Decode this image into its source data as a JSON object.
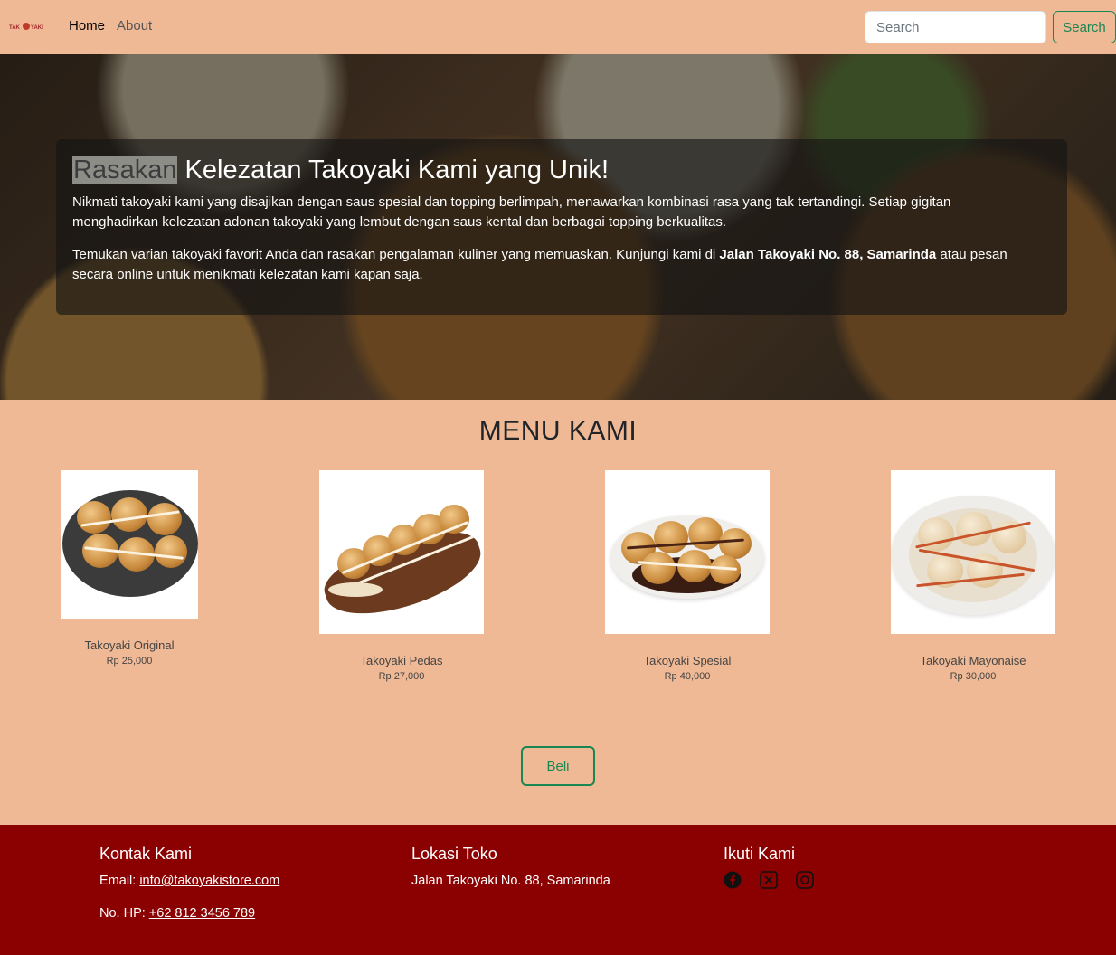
{
  "navbar": {
    "brand_icon": "takoyaki-logo",
    "home_label": "Home",
    "about_label": "About",
    "search_placeholder": "Search",
    "search_button": "Search"
  },
  "hero": {
    "title_highlight": "Rasakan",
    "title_rest": " Kelezatan Takoyaki Kami yang Unik!",
    "paragraph1": "Nikmati takoyaki kami yang disajikan dengan saus spesial dan topping berlimpah, menawarkan kombinasi rasa yang tak tertandingi. Setiap gigitan menghadirkan kelezatan adonan takoyaki yang lembut dengan saus kental dan berbagai topping berkualitas.",
    "paragraph2_before": "Temukan varian takoyaki favorit Anda dan rasakan pengalaman kuliner yang memuaskan. Kunjungi kami di ",
    "paragraph2_bold": "Jalan Takoyaki No. 88, Samarinda",
    "paragraph2_after": " atau pesan secara online untuk menikmati kelezatan kami kapan saja."
  },
  "menu": {
    "title": "MENU KAMI",
    "items": [
      {
        "name": "Takoyaki Original",
        "price": "Rp 25,000",
        "image": "takoyaki-original-photo"
      },
      {
        "name": "Takoyaki Pedas",
        "price": "Rp 27,000",
        "image": "takoyaki-pedas-photo"
      },
      {
        "name": "Takoyaki Spesial",
        "price": "Rp 40,000",
        "image": "takoyaki-spesial-photo"
      },
      {
        "name": "Takoyaki Mayonaise",
        "price": "Rp 30,000",
        "image": "takoyaki-mayonaise-photo"
      }
    ],
    "buy_button": "Beli"
  },
  "footer": {
    "contact": {
      "heading": "Kontak Kami",
      "email_label": "Email: ",
      "email": "info@takoyakistore.com",
      "phone_label": "No. HP: ",
      "phone": "+62 812 3456 789"
    },
    "location": {
      "heading": "Lokasi Toko",
      "address": "Jalan Takoyaki No. 88, Samarinda"
    },
    "social": {
      "heading": "Ikuti Kami",
      "icons": [
        "facebook-icon",
        "x-twitter-icon",
        "instagram-icon"
      ]
    }
  },
  "colors": {
    "page_background": "#f0b995",
    "footer_background": "#8b0000",
    "accent_green": "#198754"
  }
}
